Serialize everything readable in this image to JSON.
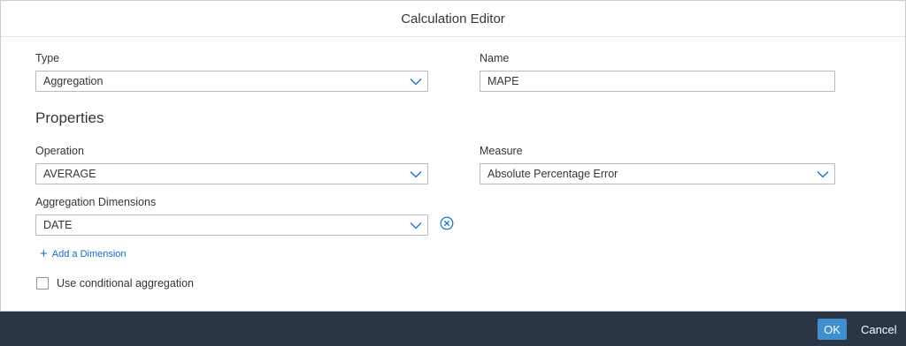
{
  "dialog": {
    "title": "Calculation Editor"
  },
  "type_field": {
    "label": "Type",
    "value": "Aggregation"
  },
  "name_field": {
    "label": "Name",
    "value": "MAPE"
  },
  "properties": {
    "heading": "Properties"
  },
  "operation_field": {
    "label": "Operation",
    "value": "AVERAGE"
  },
  "measure_field": {
    "label": "Measure",
    "value": "Absolute Percentage Error"
  },
  "aggregation_dimensions": {
    "label": "Aggregation Dimensions",
    "items": [
      {
        "value": "DATE"
      }
    ],
    "add_label": "Add a Dimension"
  },
  "conditional": {
    "label": "Use conditional aggregation",
    "checked": false
  },
  "footer": {
    "ok_label": "OK",
    "cancel_label": "Cancel"
  },
  "icons": {
    "dropdown": "chevron-down-icon",
    "remove": "close-circle-icon",
    "add": "plus-icon"
  },
  "colors": {
    "accent": "#0a6ed1",
    "ok_button": "#3e8ed0",
    "footer_bg": "#2a3646"
  }
}
